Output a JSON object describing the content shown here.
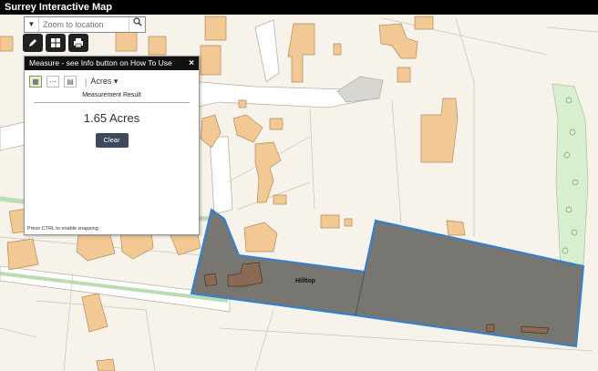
{
  "app": {
    "title": "Surrey Interactive Map"
  },
  "search": {
    "placeholder": "Zoom to location",
    "dropdown_icon": "caret-down-icon",
    "button_icon": "search-icon"
  },
  "zoom": {
    "in_label": "+",
    "out_label": "−"
  },
  "toolbar": {
    "measure_icon": "pencil-icon",
    "layers_icon": "grid-icon",
    "print_icon": "printer-icon",
    "home_icon": "home-icon",
    "locate_icon": "locate-icon"
  },
  "measure_panel": {
    "title": "Measure - see Info button on How To Use",
    "close_label": "×",
    "unit": "Acres",
    "result_title": "Measurement Result",
    "result_value": "1.65 Acres",
    "clear_label": "Clear",
    "snap_hint": "Press CTRL to enable snapping"
  },
  "map": {
    "parcel_label": "Hilltop",
    "colors": {
      "background": "#f7f3ea",
      "building_fill": "#f2c894",
      "building_stroke": "#b58a5a",
      "road_fill": "#ffffff",
      "measure_fill": "#6b6b66",
      "measure_stroke": "#2f80d9",
      "woodland": "#d7efcf",
      "path_green": "#b9dcb0"
    }
  }
}
